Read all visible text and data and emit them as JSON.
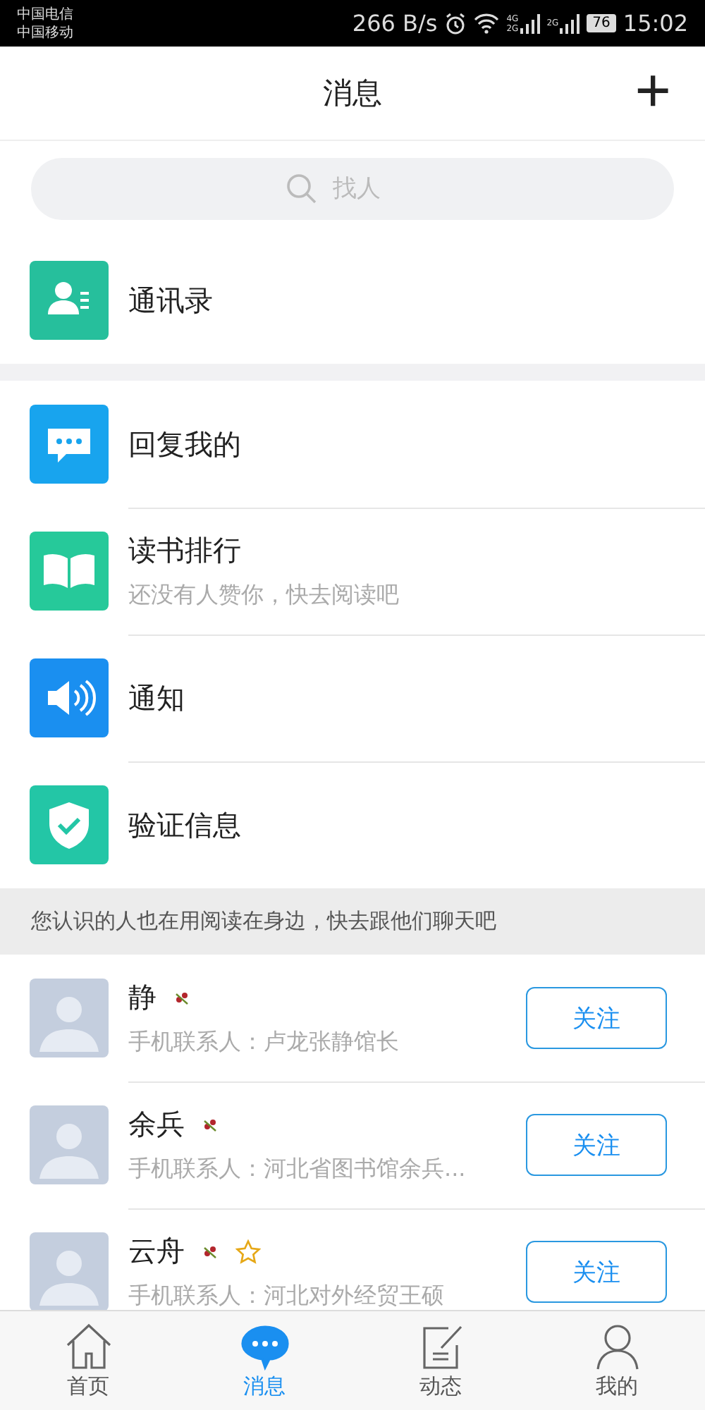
{
  "status_bar": {
    "carriers": [
      "中国电信",
      "中国移动"
    ],
    "speed": "266 B/s",
    "signals": [
      {
        "labels": [
          "4G",
          "2G"
        ]
      },
      {
        "labels": [
          "2G"
        ]
      }
    ],
    "battery": "76",
    "time": "15:02"
  },
  "header": {
    "title": "消息",
    "add": "+"
  },
  "search": {
    "placeholder": "找人"
  },
  "top_items": [
    {
      "kind": "contacts",
      "title": "通讯录"
    }
  ],
  "items": [
    {
      "kind": "reply",
      "title": "回复我的"
    },
    {
      "kind": "book",
      "title": "读书排行",
      "subtitle": "还没有人赞你，快去阅读吧"
    },
    {
      "kind": "notice",
      "title": "通知"
    },
    {
      "kind": "verify",
      "title": "验证信息"
    }
  ],
  "banner": "您认识的人也在用阅读在身边，快去跟他们聊天吧",
  "contacts": [
    {
      "name": "静",
      "badges": [
        {
          "kind": "flower"
        }
      ],
      "subtitle": "手机联系人：卢龙张静馆长",
      "button": "关注"
    },
    {
      "name": "余兵",
      "badges": [
        {
          "kind": "flower"
        }
      ],
      "subtitle": "手机联系人：河北省图书馆余兵...",
      "button": "关注"
    },
    {
      "name": "云舟",
      "badges": [
        {
          "kind": "flower"
        },
        {
          "kind": "star"
        }
      ],
      "subtitle": "手机联系人：河北对外经贸王硕",
      "button": "关注"
    }
  ],
  "tabs": [
    {
      "kind": "home",
      "label": "首页",
      "selected": false
    },
    {
      "kind": "message",
      "label": "消息",
      "selected": true
    },
    {
      "kind": "feed",
      "label": "动态",
      "selected": false
    },
    {
      "kind": "me",
      "label": "我的",
      "selected": false
    }
  ]
}
